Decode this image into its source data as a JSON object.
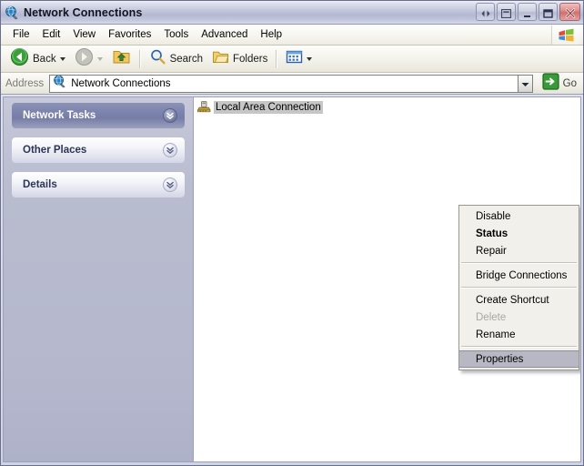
{
  "window": {
    "title": "Network Connections",
    "icon": "globe-network-icon",
    "buttons": [
      {
        "name": "resize-horizontal-button",
        "glyph": "left-right-arrows-icon"
      },
      {
        "name": "rollup-button",
        "glyph": "panel-icon"
      },
      {
        "name": "minimize-button",
        "glyph": "minimize-icon"
      },
      {
        "name": "maximize-button",
        "glyph": "maximize-icon"
      },
      {
        "name": "close-button",
        "glyph": "close-x-icon"
      }
    ]
  },
  "menubar": {
    "items": [
      {
        "label": "File"
      },
      {
        "label": "Edit"
      },
      {
        "label": "View"
      },
      {
        "label": "Favorites"
      },
      {
        "label": "Tools"
      },
      {
        "label": "Advanced"
      },
      {
        "label": "Help"
      }
    ],
    "brand_icon": "windows-flag-icon"
  },
  "toolbar": {
    "back_label": "Back",
    "back_icon": "back-arrow-icon",
    "forward_icon": "forward-arrow-icon",
    "up_label": "",
    "up_icon": "up-folder-icon",
    "search_label": "Search",
    "search_icon": "search-magnifier-icon",
    "folders_label": "Folders",
    "folders_icon": "folder-icon",
    "views_icon": "views-icon"
  },
  "address": {
    "label": "Address",
    "value": "Network Connections",
    "placeholder": "Address",
    "icon": "globe-network-icon",
    "dropdown_icon": "chevron-down-icon",
    "go_label": "Go",
    "go_icon": "green-arrow-icon"
  },
  "sidebar": {
    "panels": [
      {
        "title": "Network Tasks",
        "state": "active",
        "chevron_icon": "double-chevron-down-icon"
      },
      {
        "title": "Other Places",
        "state": "inactive",
        "chevron_icon": "double-chevron-down-icon"
      },
      {
        "title": "Details",
        "state": "inactive",
        "chevron_icon": "double-chevron-down-icon"
      }
    ]
  },
  "filelist": {
    "items": [
      {
        "label": "Local Area Connection",
        "icon": "network-adapter-icon",
        "selected": true
      }
    ]
  },
  "context_menu": {
    "items": [
      {
        "label": "Disable",
        "type": "item",
        "state": "normal"
      },
      {
        "label": "Status",
        "type": "item",
        "state": "default"
      },
      {
        "label": "Repair",
        "type": "item",
        "state": "normal"
      },
      {
        "type": "separator"
      },
      {
        "label": "Bridge Connections",
        "type": "item",
        "state": "normal"
      },
      {
        "type": "separator"
      },
      {
        "label": "Create Shortcut",
        "type": "item",
        "state": "normal"
      },
      {
        "label": "Delete",
        "type": "item",
        "state": "disabled"
      },
      {
        "label": "Rename",
        "type": "item",
        "state": "normal"
      },
      {
        "type": "separator"
      },
      {
        "label": "Properties",
        "type": "item",
        "state": "selected"
      }
    ]
  },
  "colors": {
    "titlebar_start": "#f0f1f6",
    "titlebar_end": "#b3b8d2",
    "sidebar_bg": "#b8bbce",
    "panel_active": "#7d84ad",
    "accent_green": "#2f9e2f",
    "close_red": "#d07070",
    "selection_gray": "#b8b8c4"
  }
}
